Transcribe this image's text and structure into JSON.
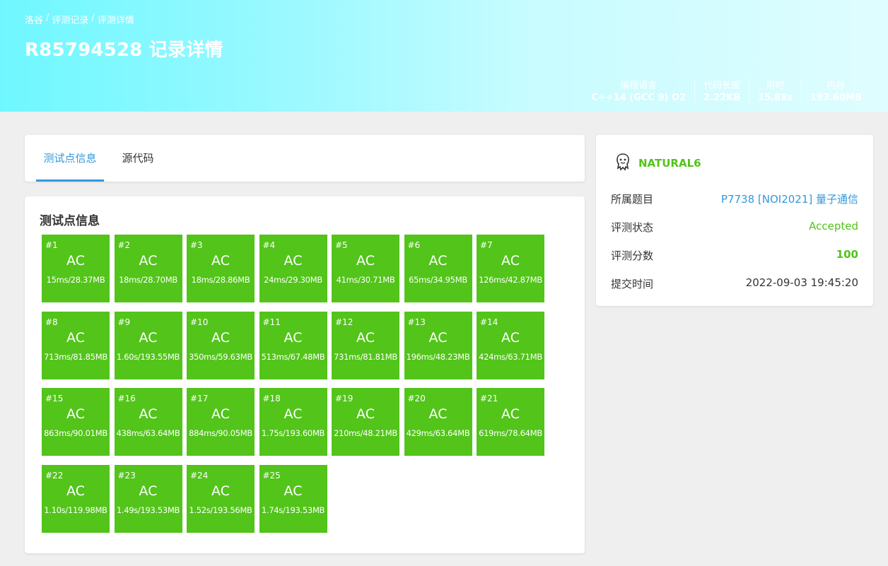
{
  "breadcrumb": [
    "洛谷",
    "评测记录",
    "评测详情"
  ],
  "breadcrumb_sep": "/",
  "title": "R85794528 记录详情",
  "stats": [
    {
      "label": "编程语言",
      "value": "C++14 (GCC 9) O2"
    },
    {
      "label": "代码长度",
      "value": "2.22KB"
    },
    {
      "label": "用时",
      "value": "15.88s"
    },
    {
      "label": "内存",
      "value": "193.60MB"
    }
  ],
  "tabs": [
    "测试点信息",
    "源代码"
  ],
  "cases_title": "测试点信息",
  "cases": [
    {
      "id": "#1",
      "status": "AC",
      "detail": "15ms/28.37MB"
    },
    {
      "id": "#2",
      "status": "AC",
      "detail": "18ms/28.70MB"
    },
    {
      "id": "#3",
      "status": "AC",
      "detail": "18ms/28.86MB"
    },
    {
      "id": "#4",
      "status": "AC",
      "detail": "24ms/29.30MB"
    },
    {
      "id": "#5",
      "status": "AC",
      "detail": "41ms/30.71MB"
    },
    {
      "id": "#6",
      "status": "AC",
      "detail": "65ms/34.95MB"
    },
    {
      "id": "#7",
      "status": "AC",
      "detail": "126ms/42.87MB"
    },
    {
      "id": "#8",
      "status": "AC",
      "detail": "713ms/81.85MB"
    },
    {
      "id": "#9",
      "status": "AC",
      "detail": "1.60s/193.55MB"
    },
    {
      "id": "#10",
      "status": "AC",
      "detail": "350ms/59.63MB"
    },
    {
      "id": "#11",
      "status": "AC",
      "detail": "513ms/67.48MB"
    },
    {
      "id": "#12",
      "status": "AC",
      "detail": "731ms/81.81MB"
    },
    {
      "id": "#13",
      "status": "AC",
      "detail": "196ms/48.23MB"
    },
    {
      "id": "#14",
      "status": "AC",
      "detail": "424ms/63.71MB"
    },
    {
      "id": "#15",
      "status": "AC",
      "detail": "863ms/90.01MB"
    },
    {
      "id": "#16",
      "status": "AC",
      "detail": "438ms/63.64MB"
    },
    {
      "id": "#17",
      "status": "AC",
      "detail": "884ms/90.05MB"
    },
    {
      "id": "#18",
      "status": "AC",
      "detail": "1.75s/193.60MB"
    },
    {
      "id": "#19",
      "status": "AC",
      "detail": "210ms/48.21MB"
    },
    {
      "id": "#20",
      "status": "AC",
      "detail": "429ms/63.64MB"
    },
    {
      "id": "#21",
      "status": "AC",
      "detail": "619ms/78.64MB"
    },
    {
      "id": "#22",
      "status": "AC",
      "detail": "1.10s/119.98MB"
    },
    {
      "id": "#23",
      "status": "AC",
      "detail": "1.49s/193.53MB"
    },
    {
      "id": "#24",
      "status": "AC",
      "detail": "1.52s/193.56MB"
    },
    {
      "id": "#25",
      "status": "AC",
      "detail": "1.74s/193.53MB"
    }
  ],
  "user": {
    "name": "NATURAL6",
    "avatar_icon": "avatar-icon"
  },
  "info": {
    "problem_label": "所属题目",
    "problem_value": "P7738 [NOI2021] 量子通信",
    "status_label": "评测状态",
    "status_value": "Accepted",
    "score_label": "评测分数",
    "score_value": "100",
    "time_label": "提交时间",
    "time_value": "2022-09-03 19:45:20"
  },
  "colors": {
    "accepted": "#52c41a",
    "link": "#3498db"
  }
}
